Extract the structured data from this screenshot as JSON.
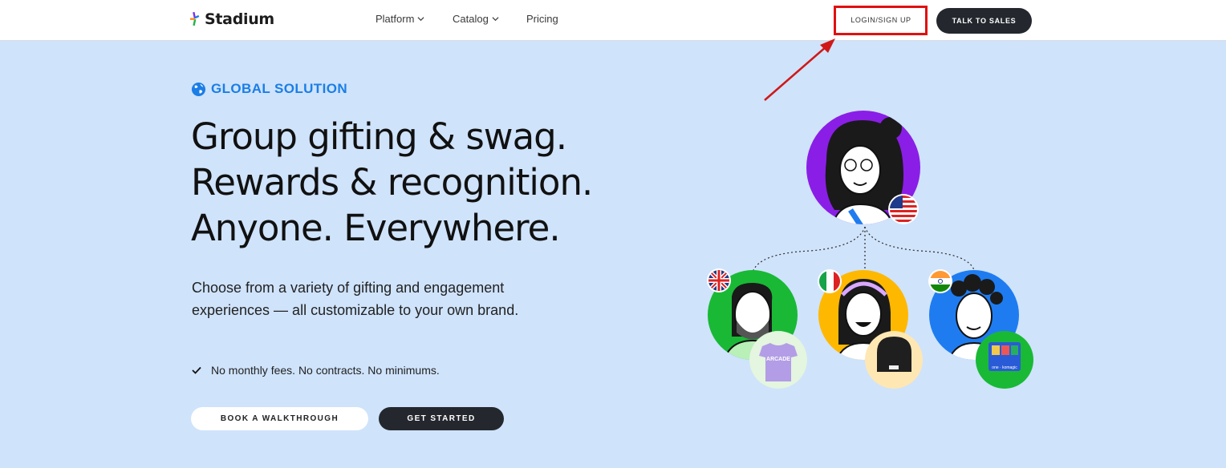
{
  "header": {
    "brand": "Stadium",
    "nav": [
      {
        "label": "Platform",
        "has_dropdown": true
      },
      {
        "label": "Catalog",
        "has_dropdown": true
      },
      {
        "label": "Pricing",
        "has_dropdown": false
      }
    ],
    "login_label": "LOGIN/SIGN UP",
    "sales_label": "TALK TO SALES"
  },
  "hero": {
    "eyebrow_icon": "globe-icon",
    "eyebrow": "GLOBAL SOLUTION",
    "headline": [
      "Group gifting & swag.",
      "Rewards & recognition.",
      "Anyone. Everywhere."
    ],
    "subcopy": "Choose from a variety of gifting and engagement experiences — all customizable to your own brand.",
    "check_item": "No monthly fees. No contracts. No minimums.",
    "btn_walkthrough": "BOOK A WALKTHROUGH",
    "btn_start": "GET STARTED"
  },
  "illustration": {
    "shirt_text": "ARCADE",
    "card_text": "one · komagic"
  },
  "colors": {
    "page_bg": "#cfe3fb",
    "accent_blue": "#1a7ee6",
    "dark_button": "#24282e",
    "annotation_red": "#e01010",
    "avatar_purple": "#8a1ee6",
    "avatar_green": "#19b935",
    "avatar_yellow": "#ffb800",
    "avatar_blue": "#1f7cf0"
  }
}
